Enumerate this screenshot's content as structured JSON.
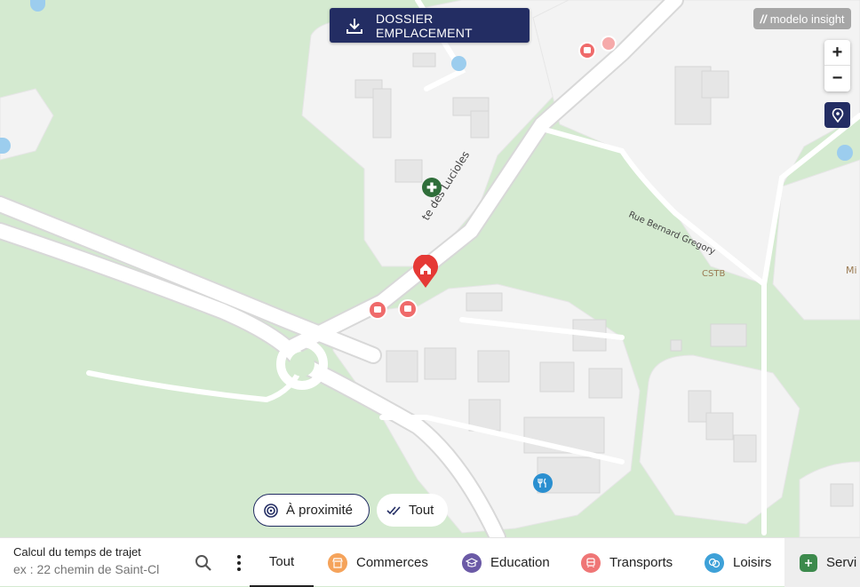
{
  "toolbar": {
    "download_label": "DOSSIER EMPLACEMENT"
  },
  "brand": {
    "name": "modelo insight"
  },
  "zoom": {
    "in": "+",
    "out": "−"
  },
  "map": {
    "street_1": "Allée des Lucioles",
    "street_1_visible": "te des Lucioles",
    "street_2": "Rue Bernard Gregory",
    "place_1": "CSTB",
    "place_2": "Mi"
  },
  "proximity": {
    "near": "À proximité",
    "all": "Tout"
  },
  "travel": {
    "title": "Calcul du temps de trajet",
    "placeholder": "ex : 22 chemin de Saint-Cl"
  },
  "tabs": [
    {
      "label": "Tout",
      "color": "#222222"
    },
    {
      "label": "Commerces",
      "color": "#f5a35b"
    },
    {
      "label": "Education",
      "color": "#6b5aa6"
    },
    {
      "label": "Transports",
      "color": "#ef7676"
    },
    {
      "label": "Loisirs",
      "color": "#3ea1d8"
    },
    {
      "label": "Servi",
      "color": "#3c8a4c"
    }
  ],
  "colors": {
    "accent": "#232d63",
    "home_marker": "#e53935",
    "park": "#d4ead0",
    "road": "#ffffff"
  }
}
